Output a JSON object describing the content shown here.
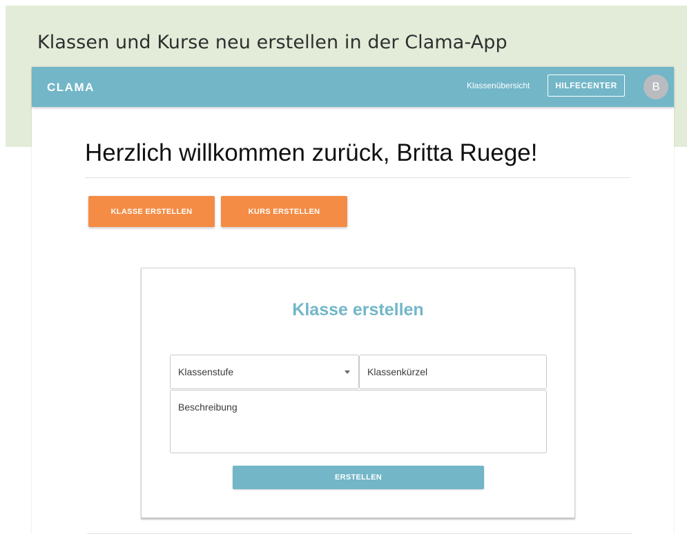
{
  "banner": {
    "title": "Klassen und Kurse neu erstellen in der Clama-App"
  },
  "navbar": {
    "brand": "CLAMA",
    "link_overview": "Klassenübersicht",
    "help_button": "HILFECENTER",
    "avatar_initial": "B"
  },
  "main": {
    "welcome": "Herzlich willkommen zurück, Britta Ruege!",
    "actions": {
      "create_class": "KLASSE ERSTELLEN",
      "create_course": "KURS ERSTELLEN"
    }
  },
  "form": {
    "title": "Klasse erstellen",
    "grade_select": {
      "label": "Klassenstufe",
      "icon": "chevron-down-icon"
    },
    "class_code": {
      "label": "Klassenkürzel"
    },
    "description": {
      "label": "Beschreibung"
    },
    "submit": "ERSTELLEN"
  },
  "colors": {
    "banner_bg": "#e3ecd8",
    "navbar_bg": "#72b6c8",
    "accent_orange": "#f48c45",
    "accent_teal": "#72b6c8"
  }
}
